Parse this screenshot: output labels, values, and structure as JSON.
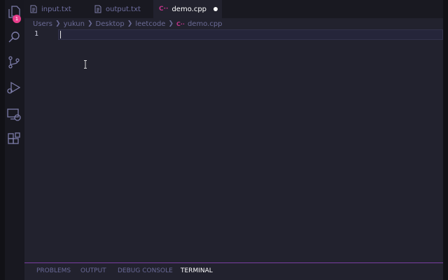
{
  "activity_bar": {
    "icons": [
      "files-icon",
      "search-icon",
      "source-control-icon",
      "run-debug-icon",
      "remote-explorer-icon",
      "extensions-icon"
    ],
    "badge": "1",
    "badge_color": "#e83e8c"
  },
  "tabs": [
    {
      "label": "input.txt",
      "icon": "file-text-icon",
      "active": false
    },
    {
      "label": "output.txt",
      "icon": "file-text-icon",
      "active": false
    },
    {
      "label": "demo.cpp",
      "icon": "cpp-file-icon",
      "icon_text": "C··",
      "active": true,
      "modified": true
    }
  ],
  "breadcrumb": [
    "Users",
    "yukun",
    "Desktop",
    "leetcode",
    "demo.cpp"
  ],
  "breadcrumb_icon_text": "C··",
  "editor": {
    "line_numbers": [
      "1"
    ],
    "content": ""
  },
  "panel": {
    "tabs": [
      "PROBLEMS",
      "OUTPUT",
      "DEBUG CONSOLE",
      "TERMINAL"
    ],
    "active_tab": "TERMINAL",
    "accent": "#7a3ea3"
  }
}
